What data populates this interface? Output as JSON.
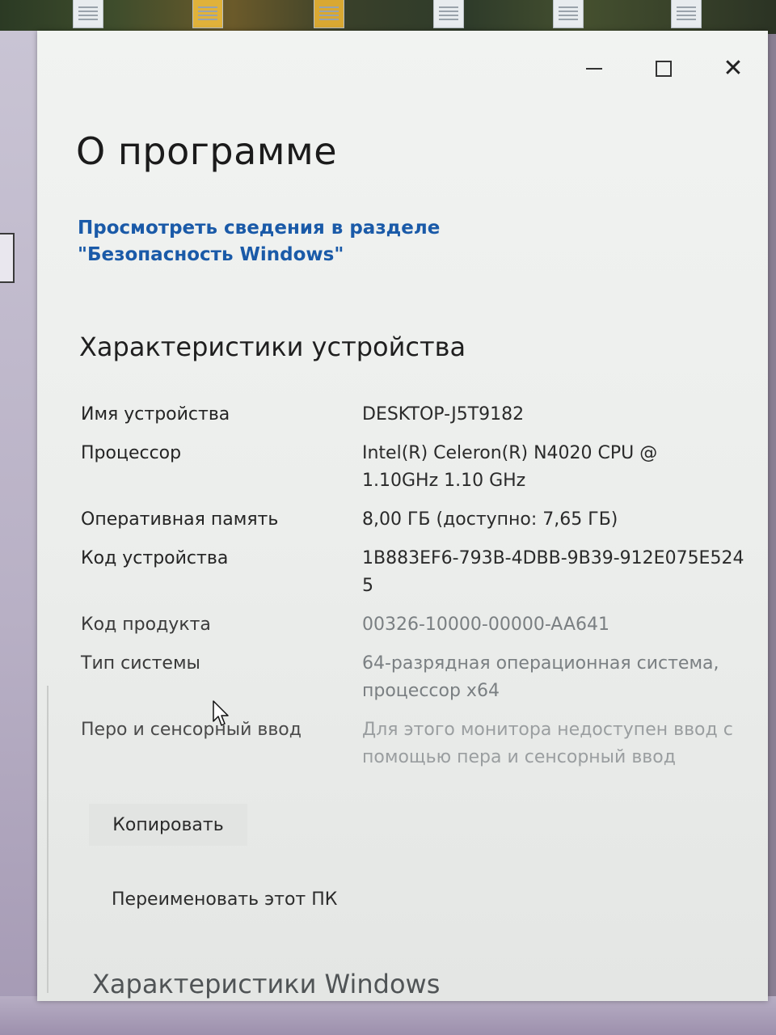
{
  "window": {
    "title": "О программе",
    "controls": {
      "minimize": "minimize",
      "maximize": "maximize",
      "close": "✕"
    }
  },
  "security_link": "Просмотреть сведения в разделе \"Безопасность Windows\"",
  "device_specs": {
    "heading": "Характеристики устройства",
    "rows": [
      {
        "label": "Имя устройства",
        "value": "DESKTOP-J5T9182"
      },
      {
        "label": "Процессор",
        "value": "Intel(R) Celeron(R) N4020 CPU @ 1.10GHz   1.10 GHz"
      },
      {
        "label": "Оперативная память",
        "value": "8,00 ГБ (доступно: 7,65 ГБ)"
      },
      {
        "label": "Код устройства",
        "value": "1B883EF6-793B-4DBB-9B39-912E075E5245"
      },
      {
        "label": "Код продукта",
        "value": "00326-10000-00000-AA641"
      },
      {
        "label": "Тип системы",
        "value": "64-разрядная операционная система, процессор x64"
      },
      {
        "label": "Перо и сенсорный ввод",
        "value": "Для этого монитора недоступен ввод с помощью пера и сенсорный ввод"
      }
    ]
  },
  "actions": {
    "copy_label": "Копировать",
    "rename_label": "Переименовать этот ПК"
  },
  "windows_specs": {
    "heading": "Характеристики Windows"
  }
}
